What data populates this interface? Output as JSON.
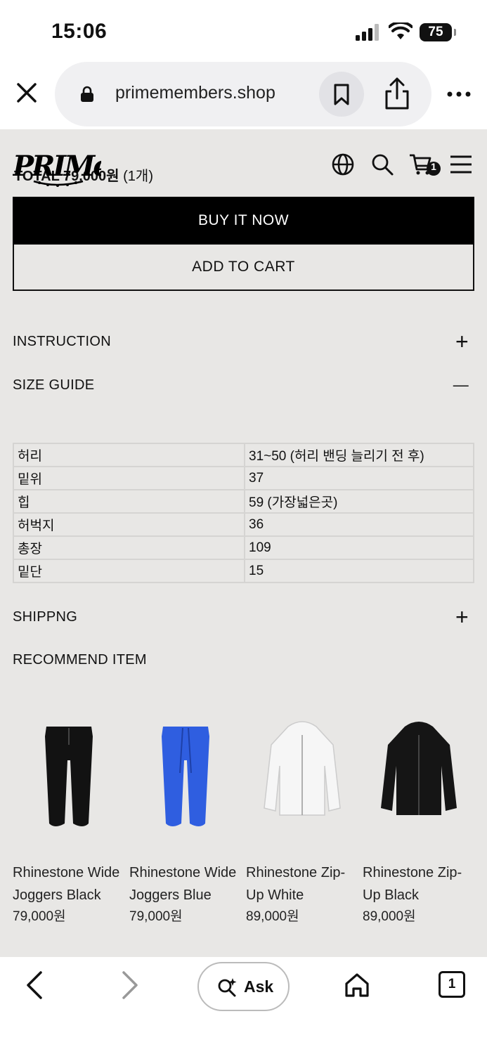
{
  "status": {
    "time": "15:06",
    "battery": "75"
  },
  "browser": {
    "url": "primemembers.shop"
  },
  "header": {
    "total_prefix": "TOTAL ",
    "total_amount": "79,000원",
    "total_count": "(1개)",
    "cart_count": "1"
  },
  "actions": {
    "buy_now": "BUY IT NOW",
    "add_to_cart": "ADD TO CART"
  },
  "accordions": {
    "instruction": {
      "label": "INSTRUCTION",
      "sign": "+"
    },
    "size_guide": {
      "label": "SIZE GUIDE",
      "sign": "—"
    },
    "shipping": {
      "label": "SHIPPNG",
      "sign": "+"
    },
    "recommend": {
      "label": "RECOMMEND ITEM"
    }
  },
  "size_table": [
    {
      "label": "허리",
      "value": "31~50 (허리 밴딩 늘리기 전 후)"
    },
    {
      "label": "밑위",
      "value": "37"
    },
    {
      "label": "힙",
      "value": "59 (가장넓은곳)"
    },
    {
      "label": "허벅지",
      "value": "36"
    },
    {
      "label": "총장",
      "value": "109"
    },
    {
      "label": "밑단",
      "value": "15"
    }
  ],
  "products": [
    {
      "name_line1": "Rhinestone Wide",
      "name_line2": "Joggers Black",
      "price": "79,000원",
      "color": "#121212"
    },
    {
      "name_line1": "Rhinestone Wide",
      "name_line2": "Joggers Blue",
      "price": "79,000원",
      "color": "#2f5ee0"
    },
    {
      "name_line1": "Rhinestone Zip-",
      "name_line2": "Up White",
      "price": "89,000원",
      "color": "#f6f6f6"
    },
    {
      "name_line1": "Rhinestone Zip-",
      "name_line2": "Up Black",
      "price": "89,000원",
      "color": "#151515"
    }
  ],
  "toolbar": {
    "ask_label": "Ask",
    "tab_count": "1"
  }
}
